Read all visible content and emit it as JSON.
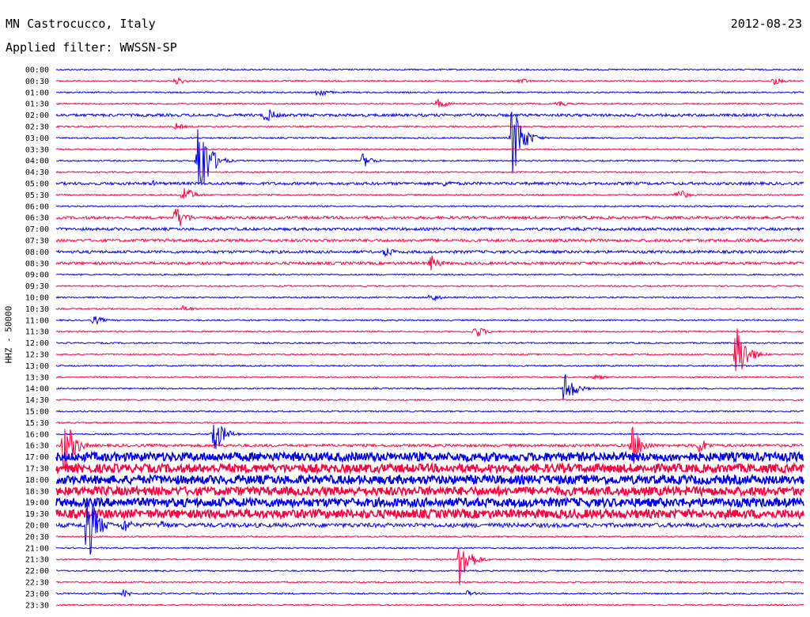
{
  "header": {
    "station": "MN Castrocucco, Italy",
    "date": "2012-08-23",
    "filter": "Applied filter: WWSSN-SP"
  },
  "channel_label": "HHZ - 50000",
  "colors": {
    "blue": "#0000ee",
    "red": "#ff0040"
  },
  "chart_data": {
    "type": "line",
    "title": "MN Castrocucco, Italy",
    "subtitle": "Applied filter: WWSSN-SP",
    "ylabel": "HHZ - 50000",
    "row_labels": [
      "00:00",
      "00:30",
      "01:00",
      "01:30",
      "02:00",
      "02:30",
      "03:00",
      "03:30",
      "04:00",
      "04:30",
      "05:00",
      "05:30",
      "06:00",
      "06:30",
      "07:00",
      "07:30",
      "08:00",
      "08:30",
      "09:00",
      "09:30",
      "10:00",
      "10:30",
      "11:00",
      "11:30",
      "12:00",
      "12:30",
      "13:00",
      "13:30",
      "14:00",
      "14:30",
      "15:00",
      "15:30",
      "16:00",
      "16:30",
      "17:00",
      "17:30",
      "18:00",
      "18:30",
      "19:00",
      "19:30",
      "20:00",
      "20:30",
      "21:00",
      "21:30",
      "22:00",
      "22:30",
      "23:00",
      "23:30"
    ],
    "row_noise_level": [
      1,
      1,
      1,
      1,
      2,
      1,
      1,
      1,
      1,
      1,
      2,
      1,
      1,
      2,
      2,
      2,
      2,
      2,
      1,
      1,
      1,
      1,
      1,
      1,
      1,
      1,
      1,
      1,
      1,
      1,
      1,
      1,
      1,
      2,
      6,
      6,
      6,
      6,
      6,
      6,
      3,
      1,
      1,
      1,
      1,
      1,
      1,
      1
    ],
    "events": [
      {
        "row": 1,
        "t": 0.16,
        "amp": 6
      },
      {
        "row": 1,
        "t": 0.62,
        "amp": 5
      },
      {
        "row": 1,
        "t": 0.96,
        "amp": 6
      },
      {
        "row": 2,
        "t": 0.35,
        "amp": 8
      },
      {
        "row": 3,
        "t": 0.51,
        "amp": 8
      },
      {
        "row": 3,
        "t": 0.67,
        "amp": 6
      },
      {
        "row": 4,
        "t": 0.28,
        "amp": 12
      },
      {
        "row": 5,
        "t": 0.16,
        "amp": 5
      },
      {
        "row": 6,
        "t": 0.61,
        "amp": 55
      },
      {
        "row": 8,
        "t": 0.19,
        "amp": 72
      },
      {
        "row": 8,
        "t": 0.41,
        "amp": 10
      },
      {
        "row": 10,
        "t": 0.52,
        "amp": 6
      },
      {
        "row": 10,
        "t": 0.13,
        "amp": 4
      },
      {
        "row": 11,
        "t": 0.17,
        "amp": 14
      },
      {
        "row": 11,
        "t": 0.83,
        "amp": 10
      },
      {
        "row": 13,
        "t": 0.16,
        "amp": 18
      },
      {
        "row": 16,
        "t": 0.44,
        "amp": 8
      },
      {
        "row": 17,
        "t": 0.5,
        "amp": 12
      },
      {
        "row": 20,
        "t": 0.5,
        "amp": 7
      },
      {
        "row": 21,
        "t": 0.17,
        "amp": 5
      },
      {
        "row": 22,
        "t": 0.05,
        "amp": 7
      },
      {
        "row": 23,
        "t": 0.56,
        "amp": 10
      },
      {
        "row": 25,
        "t": 0.91,
        "amp": 45
      },
      {
        "row": 27,
        "t": 0.72,
        "amp": 5
      },
      {
        "row": 28,
        "t": 0.68,
        "amp": 24
      },
      {
        "row": 32,
        "t": 0.21,
        "amp": 30
      },
      {
        "row": 33,
        "t": 0.01,
        "amp": 45
      },
      {
        "row": 33,
        "t": 0.77,
        "amp": 30
      },
      {
        "row": 33,
        "t": 0.86,
        "amp": 12
      },
      {
        "row": 40,
        "t": 0.04,
        "amp": 60
      },
      {
        "row": 40,
        "t": 0.09,
        "amp": 12
      },
      {
        "row": 40,
        "t": 0.14,
        "amp": 8
      },
      {
        "row": 43,
        "t": 0.54,
        "amp": 38
      },
      {
        "row": 46,
        "t": 0.09,
        "amp": 5
      },
      {
        "row": 46,
        "t": 0.55,
        "amp": 4
      }
    ]
  }
}
